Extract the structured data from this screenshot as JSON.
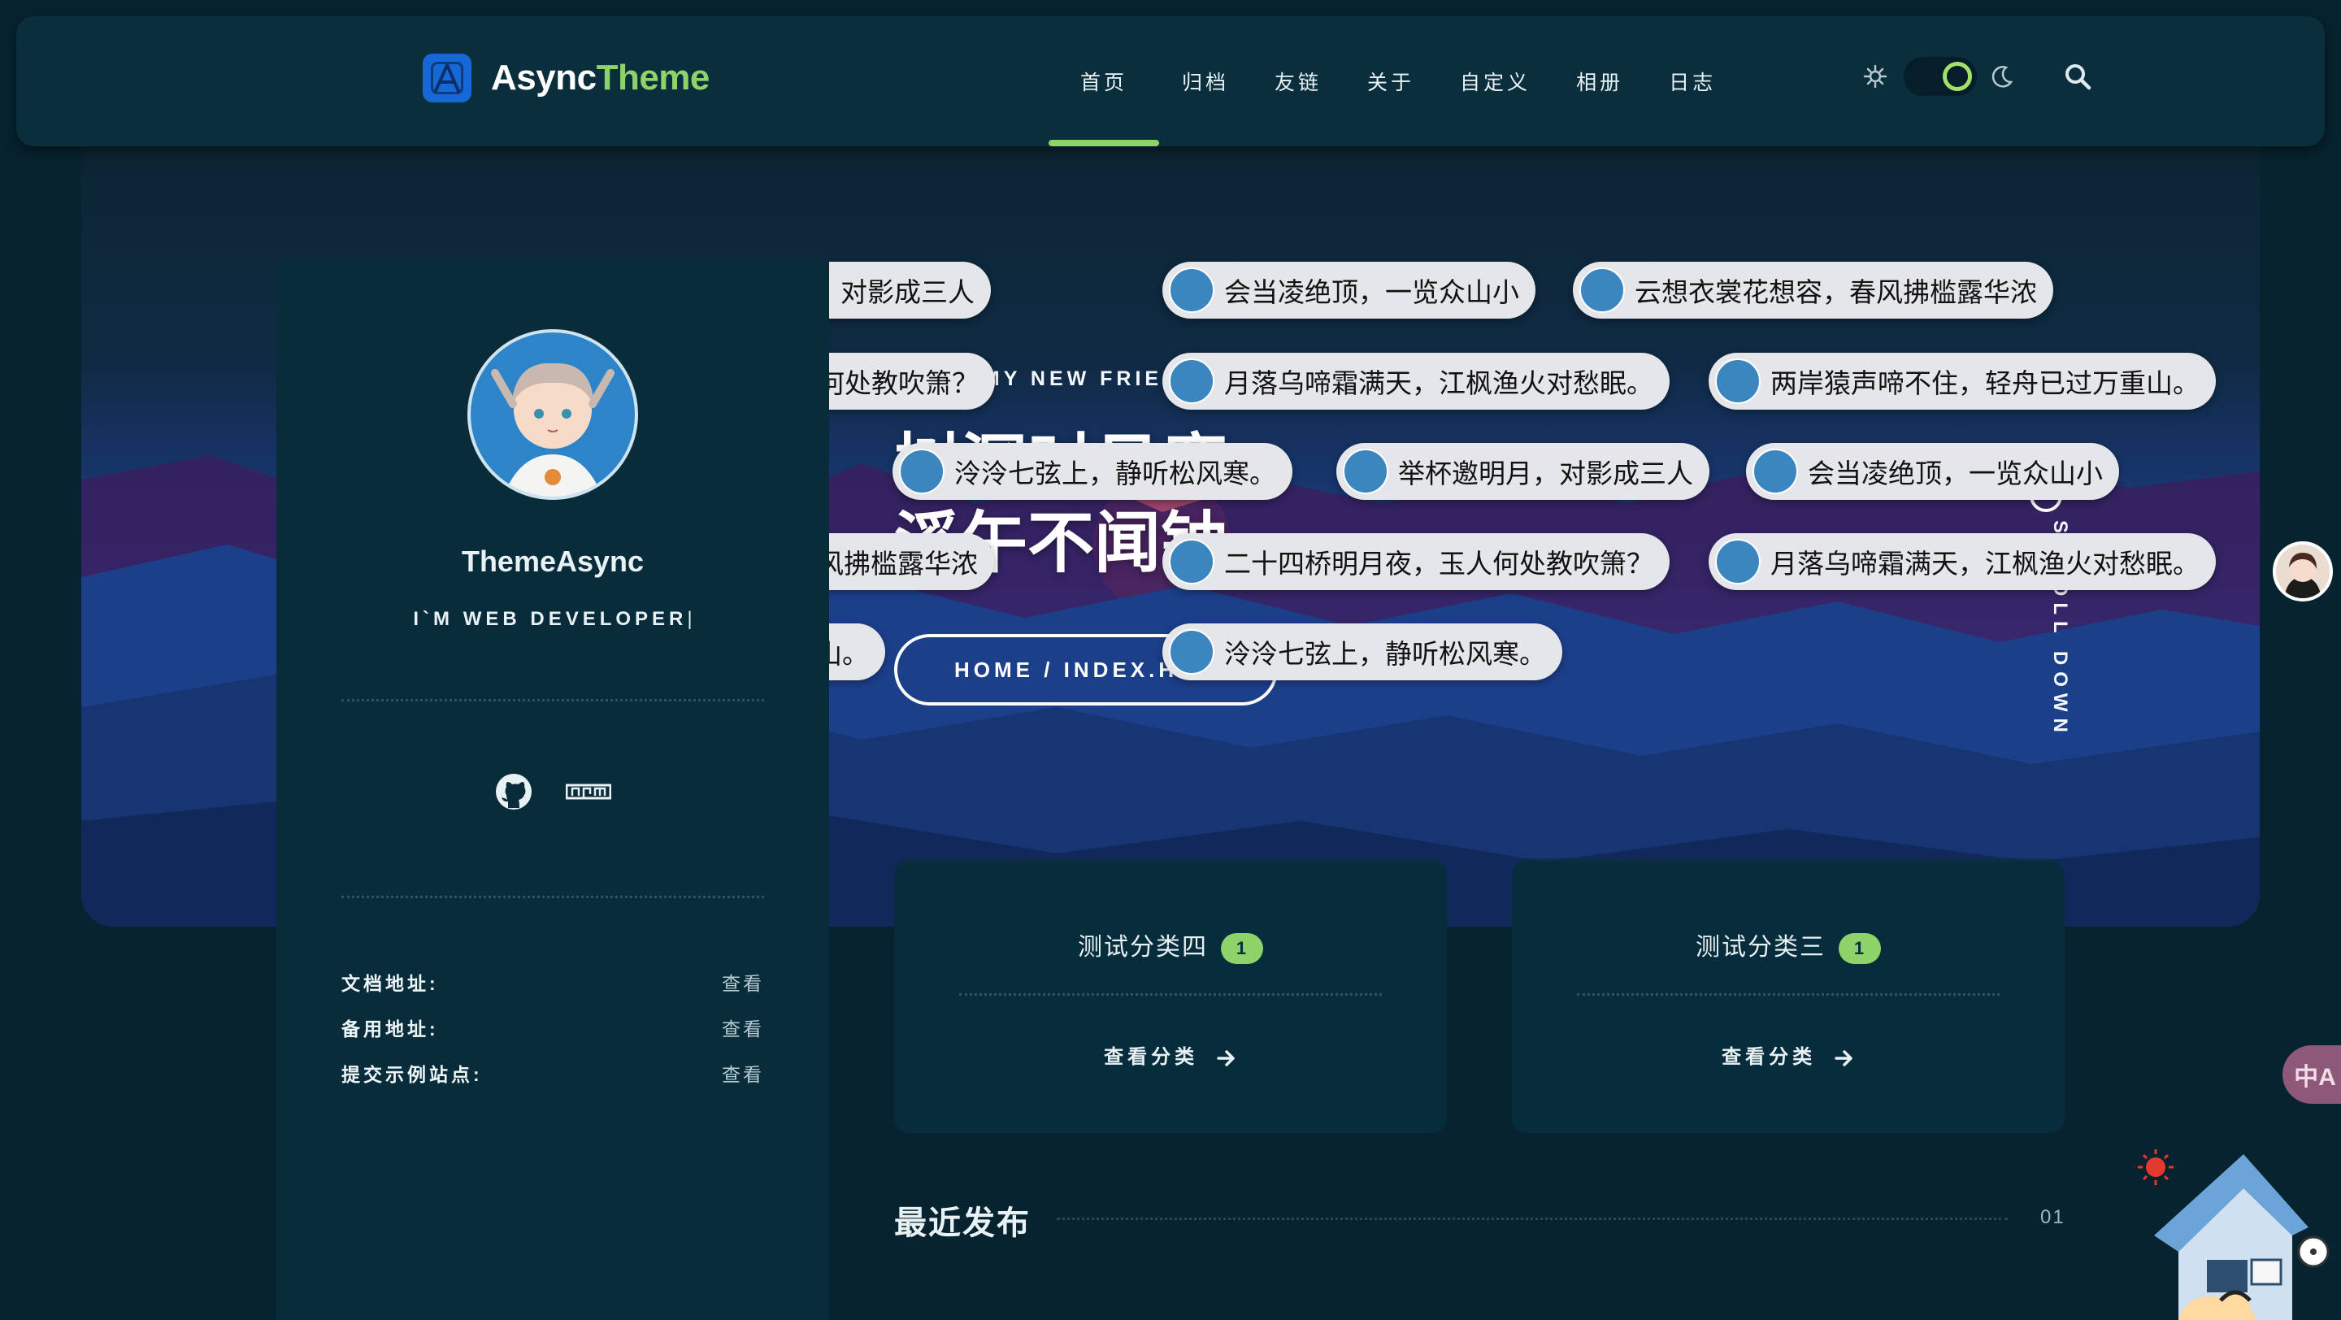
{
  "brand": {
    "name_part1": "Async",
    "name_part2": "Theme",
    "logo_glyph": "A"
  },
  "nav": {
    "items": [
      "首页",
      "归档",
      "友链",
      "关于",
      "自定义",
      "相册",
      "日志"
    ],
    "active_index": 0
  },
  "hero": {
    "greeting": "HI, MY NEW FRIEND!",
    "motto_line1": "树深时见鹿,",
    "motto_line2": "溪午不闻钟。",
    "breadcrumb": "HOME / INDEX.HTML",
    "scroll_text": "SCROLL DOWN"
  },
  "barrage": [
    {
      "text": "举杯邀明月，对影成三人"
    },
    {
      "text": "会当凌绝顶，一览众山小"
    },
    {
      "text": "云想衣裳花想容，春风拂槛露华浓"
    },
    {
      "text": "二十四桥明月夜，玉人何处教吹箫？"
    },
    {
      "text": "月落乌啼霜满天，江枫渔火对愁眠。"
    },
    {
      "text": "两岸猿声啼不住，轻舟已过万重山。"
    },
    {
      "text": "泠泠七弦上，静听松风寒。"
    },
    {
      "text": "举杯邀明月，对影成三人"
    },
    {
      "text": "会当凌绝顶，一览众山小"
    },
    {
      "text": "云想衣裳花想容，春风拂槛露华浓"
    },
    {
      "text": "二十四桥明月夜，玉人何处教吹箫？"
    },
    {
      "text": "月落乌啼霜满天，江枫渔火对愁眠。"
    },
    {
      "text": "两岸猿声啼不住，轻舟已过万重山。"
    },
    {
      "text": "泠泠七弦上，静听松风寒。"
    }
  ],
  "sidebar": {
    "author": "ThemeAsync",
    "role": "I`M WEB DEVELOPER",
    "socials": [
      "github-icon",
      "npm-icon"
    ],
    "links": [
      {
        "label": "文档地址:",
        "value": "查看"
      },
      {
        "label": "备用地址:",
        "value": "查看"
      },
      {
        "label": "提交示例站点:",
        "value": "查看"
      }
    ]
  },
  "categories": [
    {
      "name": "测试分类四",
      "count": "1",
      "link": "查看分类"
    },
    {
      "name": "测试分类三",
      "count": "1",
      "link": "查看分类"
    }
  ],
  "recent": {
    "title": "最近发布",
    "index": "01"
  },
  "translate_label": "中A",
  "colors": {
    "accent": "#8ed36a",
    "header_bg": "#0a2e3c",
    "page_bg": "#07232f"
  }
}
